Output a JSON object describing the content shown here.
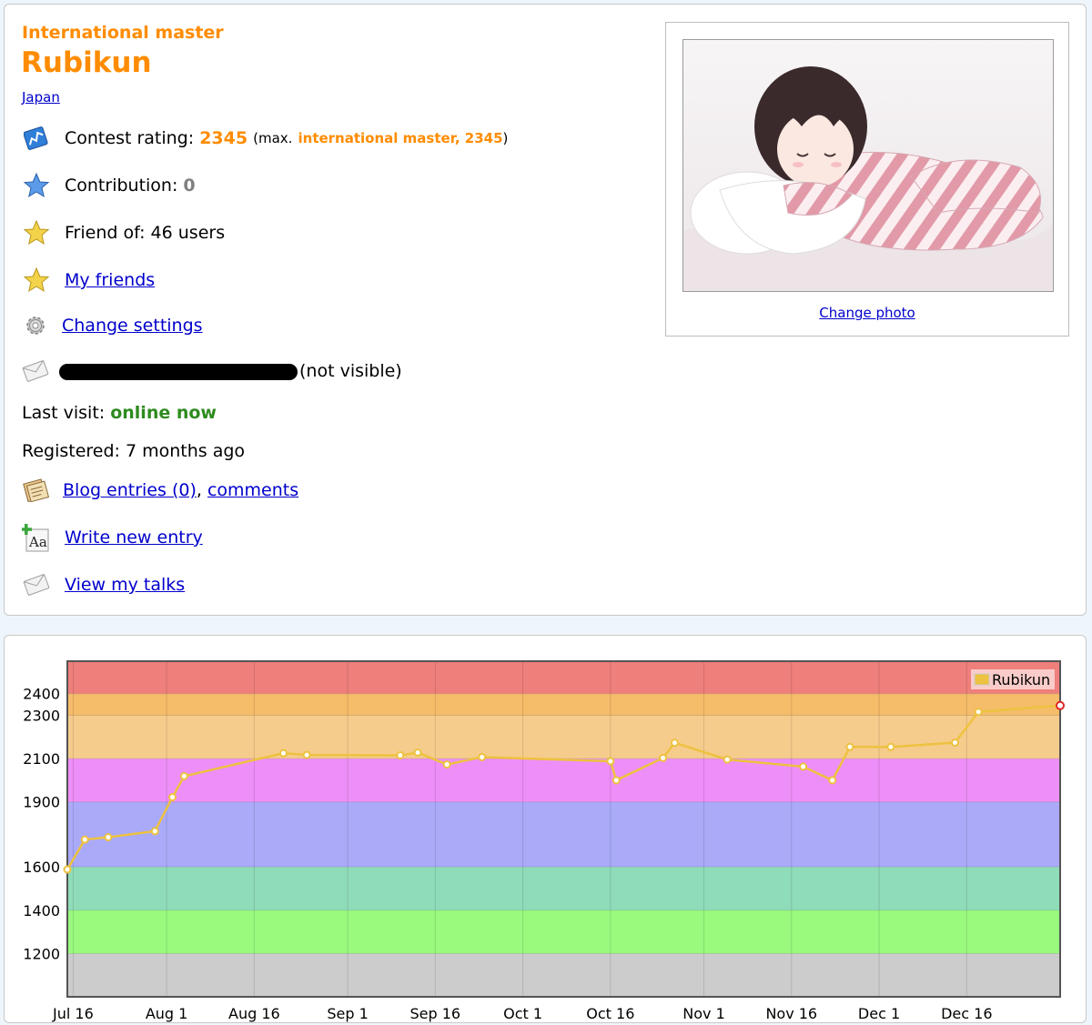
{
  "profile": {
    "rank": "International master",
    "handle": "Rubikun",
    "country": "Japan",
    "rating_label": "Contest rating:",
    "rating_value": "2345",
    "max_prefix": "(max.",
    "max_value": "international master, 2345",
    "max_suffix": ")",
    "contribution_label": "Contribution:",
    "contribution_value": "0",
    "friend_of": "Friend of: 46 users",
    "my_friends": "My friends",
    "change_settings": "Change settings",
    "email_note": "(not visible)",
    "last_visit_label": "Last visit:",
    "last_visit_value": "online now",
    "registered": "Registered: 7 months ago",
    "blog_entries": "Blog entries (0)",
    "comma": ",",
    "comments": "comments",
    "write_entry": "Write new entry",
    "view_talks": "View my talks",
    "change_photo": "Change photo"
  },
  "icons": [
    "rating-chart-icon",
    "contribution-star-icon",
    "friend-star-icon",
    "my-friends-star-icon",
    "gear-icon",
    "envelope-icon",
    "blog-icon",
    "write-entry-icon",
    "talks-envelope-icon"
  ],
  "colors": {
    "rank": "#ff8c00",
    "online": "#2e8b1f",
    "link": "#0000cc",
    "series": "#edc240"
  },
  "chart_data": {
    "type": "line",
    "series": [
      {
        "name": "Rubikun",
        "color": "#edc240",
        "points": [
          [
            "Jul 15",
            1588
          ],
          [
            "Jul 18",
            1726
          ],
          [
            "Jul 22",
            1737
          ],
          [
            "Jul 30",
            1765
          ],
          [
            "Aug 2",
            1922
          ],
          [
            "Aug 4",
            2019
          ],
          [
            "Aug 21",
            2125
          ],
          [
            "Aug 25",
            2117
          ],
          [
            "Sep 10",
            2115
          ],
          [
            "Sep 13",
            2128
          ],
          [
            "Sep 18",
            2073
          ],
          [
            "Sep 24",
            2107
          ],
          [
            "Oct 16",
            2088
          ],
          [
            "Oct 17",
            2000
          ],
          [
            "Oct 25",
            2103
          ],
          [
            "Oct 27",
            2173
          ],
          [
            "Nov 5",
            2096
          ],
          [
            "Nov 18",
            2063
          ],
          [
            "Nov 23",
            2000
          ],
          [
            "Nov 26",
            2154
          ],
          [
            "Dec 3",
            2154
          ],
          [
            "Dec 14",
            2174
          ],
          [
            "Dec 18",
            2316
          ],
          [
            "Jan 1",
            2345
          ]
        ]
      }
    ],
    "xticks": [
      "Jul 16",
      "Aug 1",
      "Aug 16",
      "Sep 1",
      "Sep 16",
      "Oct 1",
      "Oct 16",
      "Nov 1",
      "Nov 16",
      "Dec 1",
      "Dec 16"
    ],
    "yticks": [
      1200,
      1400,
      1600,
      1900,
      2100,
      2300,
      2400
    ],
    "ylim": [
      1000,
      2550
    ],
    "xlim": [
      "Jul 15",
      "Jan 1"
    ],
    "legend": "top-right",
    "grid": true,
    "bands": [
      {
        "from": 1000,
        "to": 1200,
        "color": "#cccccc"
      },
      {
        "from": 1200,
        "to": 1400,
        "color": "#99fa7e"
      },
      {
        "from": 1400,
        "to": 1600,
        "color": "#8fdcb9"
      },
      {
        "from": 1600,
        "to": 1900,
        "color": "#aaaaf9"
      },
      {
        "from": 1900,
        "to": 2100,
        "color": "#ee8ef8"
      },
      {
        "from": 2100,
        "to": 2300,
        "color": "#f6cc8c"
      },
      {
        "from": 2300,
        "to": 2400,
        "color": "#f5bc6a"
      },
      {
        "from": 2400,
        "to": 2550,
        "color": "#ef7f7b"
      }
    ]
  }
}
